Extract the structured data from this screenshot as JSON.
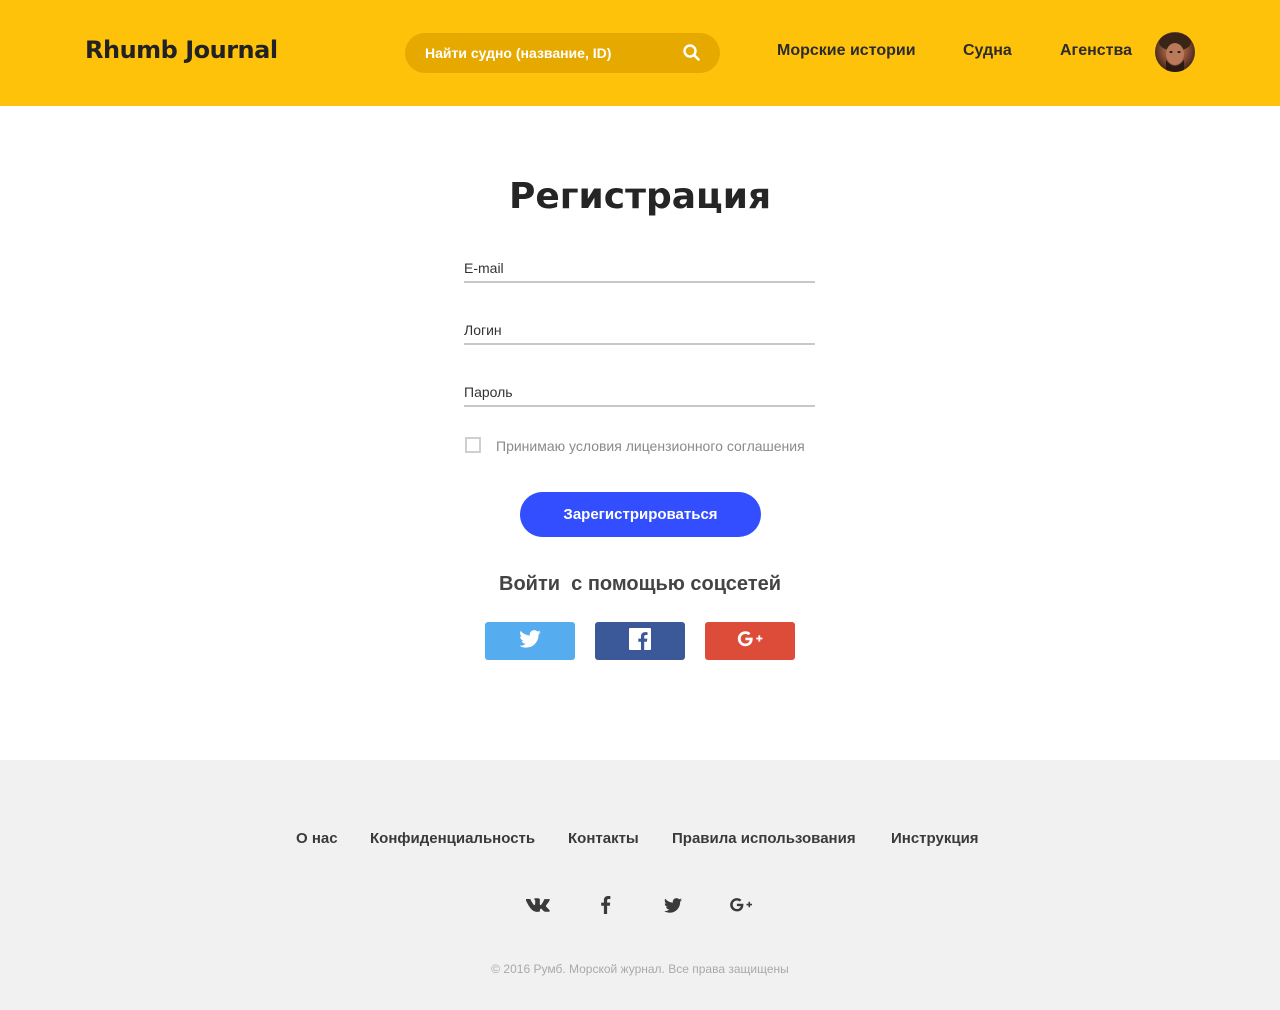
{
  "header": {
    "logo": "Rhumb Journal",
    "search_placeholder": "Найти судно (название, ID)",
    "nav": [
      {
        "label": "Морские истории"
      },
      {
        "label": "Судна"
      },
      {
        "label": "Агенства"
      }
    ],
    "accent_color": "#ffc20a"
  },
  "form": {
    "title": "Регистрация",
    "fields": [
      {
        "placeholder": "E-mail",
        "value": ""
      },
      {
        "placeholder": "Логин",
        "value": ""
      },
      {
        "placeholder": "Пароль",
        "value": ""
      }
    ],
    "agreement_label": "Принимаю условия лицензионного соглашения",
    "agreement_checked": false,
    "submit_label": "Зарегистрироваться",
    "submit_color": "#334eff"
  },
  "social": {
    "title": "Войти  с помощью соцсетей",
    "buttons": [
      {
        "icon": "twitter-icon",
        "color": "#55acee"
      },
      {
        "icon": "facebook-icon",
        "color": "#3b5998"
      },
      {
        "icon": "google-plus-icon",
        "color": "#dd4b39"
      }
    ]
  },
  "footer": {
    "links": [
      {
        "label": "О нас"
      },
      {
        "label": "Конфиденциальность"
      },
      {
        "label": "Контакты"
      },
      {
        "label": "Правила использования"
      },
      {
        "label": "Инструкция"
      }
    ],
    "social_icons": [
      "vk-icon",
      "facebook-icon",
      "twitter-icon",
      "google-plus-icon"
    ],
    "copyright": "© 2016 Румб. Морской журнал. Все права защищены"
  }
}
